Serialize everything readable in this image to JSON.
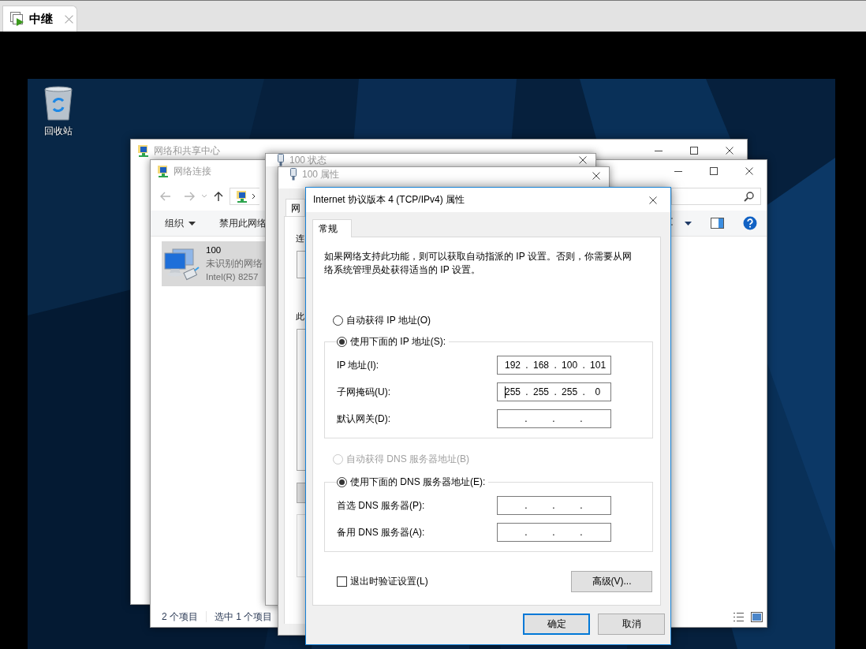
{
  "app_tab": {
    "title": "中继",
    "selected": true
  },
  "desktop_icons": [
    {
      "label": "回收站"
    }
  ],
  "sharing_center_window": {
    "title": "网络和共享中心"
  },
  "explorer_window": {
    "title": "网络连接",
    "toolbar": [
      "组织",
      "禁用此网络"
    ],
    "items": [
      {
        "name": "100",
        "status": "未识别的网络",
        "adapter": "Intel(R) 8257",
        "selected": true
      }
    ],
    "status_bar": [
      "2 个项目",
      "选中 1 个项目"
    ]
  },
  "status_window": {
    "title": "100 状态"
  },
  "properties_window": {
    "title": "100 属性",
    "tab": "网",
    "labels": [
      "连",
      "此"
    ]
  },
  "dialog": {
    "title": "Internet 协议版本 4 (TCP/IPv4) 属性",
    "tabs": [
      {
        "label": "常规",
        "selected": true
      }
    ],
    "description": "如果网络支持此功能，则可以获取自动指派的 IP 设置。否则，你需要从网络系统管理员处获得适当的 IP 设置。",
    "sections": [
      {
        "auto_radio": {
          "label": "自动获得 IP 地址(O)",
          "selected": false,
          "disabled": false
        },
        "manual_radio": {
          "label": "使用下面的 IP 地址(S):",
          "selected": true,
          "disabled": false
        },
        "fields": [
          {
            "label": "IP 地址(I):",
            "value": "192 . 168 . 100 . 101",
            "focused": false
          },
          {
            "label": "子网掩码(U):",
            "value": "255 . 255 . 255 .  0",
            "focused": true
          },
          {
            "label": "默认网关(D):",
            "value": "    .     .     .",
            "focused": false
          }
        ]
      },
      {
        "auto_radio": {
          "label": "自动获得 DNS 服务器地址(B)",
          "selected": false,
          "disabled": true
        },
        "manual_radio": {
          "label": "使用下面的 DNS 服务器地址(E):",
          "selected": true,
          "disabled": false
        },
        "fields": [
          {
            "label": "首选 DNS 服务器(P):",
            "value": "    .     .     .",
            "focused": false
          },
          {
            "label": "备用 DNS 服务器(A):",
            "value": "    .     .     .",
            "focused": false
          }
        ]
      }
    ],
    "validate_checkbox": {
      "label": "退出时验证设置(L)",
      "checked": false
    },
    "advanced_button": "高级(V)...",
    "buttons": [
      {
        "label": "确定",
        "default": true
      },
      {
        "label": "取消",
        "default": false
      }
    ]
  }
}
